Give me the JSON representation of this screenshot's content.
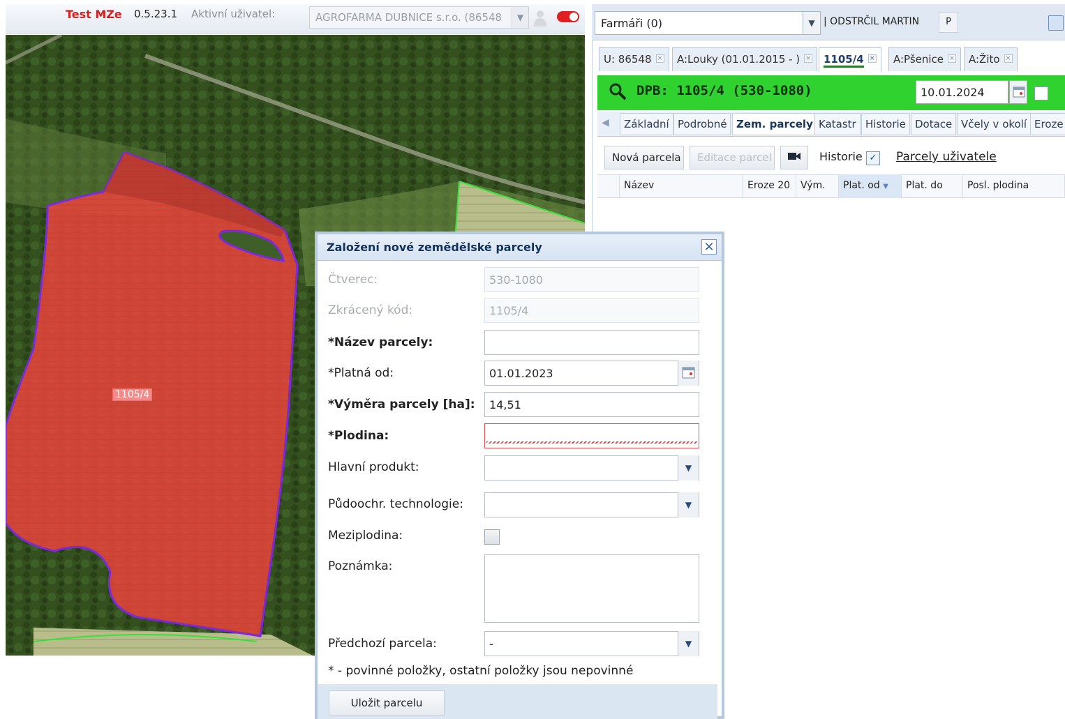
{
  "topbar": {
    "app_name": "Test MZe",
    "version": "0.5.23.1",
    "active_user_label": "Aktivní uživatel:",
    "farm_select_value": "AGROFARMA DUBNICE s.r.o. (86548"
  },
  "map": {
    "parcel_label": "1105/4",
    "colors": {
      "parcel_fill": "#e8453c",
      "parcel_border": "#7b2bd6",
      "neighbour_border": "#3be03b"
    }
  },
  "right": {
    "farmers_select": "Farmáři (0)",
    "current_user": "| ODSTRČIL MARTIN",
    "p_button": "P",
    "tabs": [
      {
        "label": "U: 86548"
      },
      {
        "label": "A:Louky (01.01.2015 - )"
      },
      {
        "label": "1105/4"
      },
      {
        "label": "A:Pšenice"
      },
      {
        "label": "A:Žito"
      }
    ],
    "dpb_title": "DPB: 1105/4 (530-1080)",
    "dpb_date": "10.01.2024",
    "subtabs": [
      {
        "label": "Základní"
      },
      {
        "label": "Podrobné"
      },
      {
        "label": "Zem. parcely"
      },
      {
        "label": "Katastr"
      },
      {
        "label": "Historie"
      },
      {
        "label": "Dotace"
      },
      {
        "label": "Včely v okolí"
      },
      {
        "label": "Eroze"
      }
    ],
    "toolbar": {
      "new_parcel": "Nová parcela",
      "edit_parcel": "Editace parcel",
      "history_label": "Historie",
      "user_parcels_link": "Parcely uživatele"
    },
    "grid_columns": [
      {
        "label": "Název"
      },
      {
        "label": "Eroze 20"
      },
      {
        "label": "Vým."
      },
      {
        "label": "Plat. od"
      },
      {
        "label": "Plat. do"
      },
      {
        "label": "Posl. plodina"
      }
    ],
    "colors": {
      "dpb_bar": "#2fd22f"
    }
  },
  "dialog": {
    "title": "Založení nové zemědělské parcely",
    "fields": {
      "square_label": "Čtverec:",
      "square_value": "530-1080",
      "short_code_label": "Zkrácený kód:",
      "short_code_value": "1105/4",
      "name_label": "*Název parcely:",
      "name_value": "",
      "valid_from_label": "*Platná od:",
      "valid_from_value": "01.01.2023",
      "area_label": "*Výměra parcely [ha]:",
      "area_value": "14,51",
      "crop_label": "*Plodina:",
      "crop_value": "",
      "main_product_label": "Hlavní produkt:",
      "main_product_value": "",
      "soil_tech_label": "Půdoochr. technologie:",
      "soil_tech_value": "",
      "cover_crop_label": "Meziplodina:",
      "note_label": "Poznámka:",
      "prev_parcel_label": "Předchozí parcela:",
      "prev_parcel_value": "-"
    },
    "footnote": "* - povinné položky, ostatní položky jsou nepovinné",
    "save_button": "Uložit parcelu"
  }
}
